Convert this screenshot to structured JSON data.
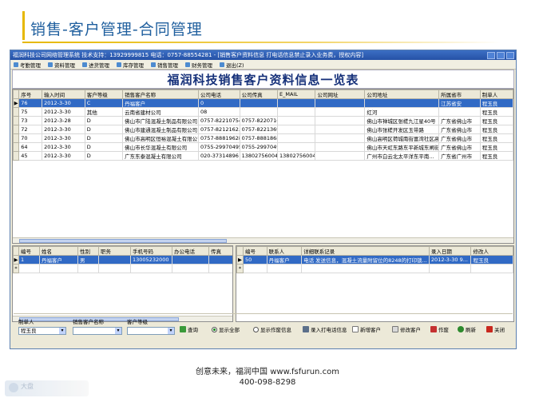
{
  "slide": {
    "title": "销售-客户管理-合同管理",
    "footer_line1": "创意未来，福润中国 www.fsfurun.com",
    "footer_line2": "400-098-8298",
    "logo_text": "大盘"
  },
  "window": {
    "titlebar": "福润科技公司网络管理系统  技术支持：13929999815  电话：0757-88554281 - [销售客户资料信息  打电话信息禁止录入业务费，授权内容]",
    "menu": [
      "考勤管理",
      "资料管理",
      "进货管理",
      "库存管理",
      "销售管理",
      "财务管理",
      "退出(Z)"
    ],
    "report_title": "福润科技销售客户资料信息一览表"
  },
  "main_table": {
    "columns": [
      "序号",
      "输入时间",
      "客户等级",
      "销售客户名称",
      "公司电话",
      "公司传真",
      "E_MAIL",
      "公司网址",
      "公司地址",
      "所属省市",
      "制单人"
    ],
    "rows": [
      [
        "76",
        "2012-3-30",
        "C",
        "丹福客户",
        "0",
        "",
        "",
        "",
        "",
        "江苏省安",
        "程玉良"
      ],
      [
        "75",
        "2012-3-30",
        "其他",
        "云南省建材公司",
        "08",
        "",
        "",
        "",
        "红河",
        "",
        "程玉良"
      ],
      [
        "73",
        "2012-3-28",
        "D",
        "佛山市广陆混凝土制品有限公司",
        "0757-82210754",
        "0757-82207166",
        "",
        "",
        "佛山市禅城区张槎九江星40号",
        "广东省佛山市",
        "程玉良"
      ],
      [
        "72",
        "2012-3-30",
        "D",
        "佛山市建通混凝土制品有限公司",
        "0757-8212162...",
        "0757-82213696",
        "",
        "",
        "佛山市张槎开发区玉带路",
        "广东省佛山市",
        "程玉良"
      ],
      [
        "70",
        "2012-3-30",
        "D",
        "佛山市高明区恒裕混凝土有限公司",
        "0757-88819628",
        "0757-88818682",
        "",
        "",
        "佛山高明区荷城南街富湾社区高...",
        "广东省佛山市",
        "程玉良"
      ],
      [
        "64",
        "2012-3-30",
        "D",
        "佛山市长华混凝土有限公司",
        "0755-29970495",
        "0755-29970495",
        "",
        "",
        "佛山市天虹东路东平新城东闸街",
        "广东省佛山市",
        "程玉良"
      ],
      [
        "45",
        "2012-3-30",
        "D",
        "广东东泰混凝土有限公司",
        "020-37314896",
        "13802756004B...",
        "13802756004B...",
        "",
        "广州市白云北太平洋东平南...",
        "广东省广州市",
        "程玉良"
      ]
    ]
  },
  "contact_table": {
    "columns": [
      "编号",
      "姓名",
      "性别",
      "职务",
      "手机号码",
      "办公电话",
      "传真"
    ],
    "rows": [
      [
        "1",
        "丹福客户",
        "男",
        "",
        "13005232000",
        "",
        ""
      ]
    ]
  },
  "log_table": {
    "columns": [
      "编号",
      "联系人",
      "详细联系记录",
      "录入日期",
      "修改人"
    ],
    "rows": [
      [
        "50",
        "丹福客户",
        "电话 发送信息，混凝土流量附留位的8248的打印锁...",
        "2012-3-30 9...",
        "程玉良"
      ]
    ]
  },
  "filters": {
    "maker_label": "制单人",
    "maker_value": "程玉良",
    "customer_label": "销售客户名称",
    "customer_value": "",
    "level_label": "客户等级",
    "level_value": ""
  },
  "actions": {
    "query": "查询",
    "show_all": "显示全部",
    "show_unfinished": "显示作废信息",
    "import_call": "录入打电话信息",
    "new_customer": "新增客户",
    "edit_customer": "修改客户",
    "void": "作废",
    "refresh": "刷新",
    "close": "关闭"
  },
  "colors": {
    "title_blue": "#1f5f9e",
    "accent_gold": "#e6b800",
    "selection": "#316ac5"
  }
}
